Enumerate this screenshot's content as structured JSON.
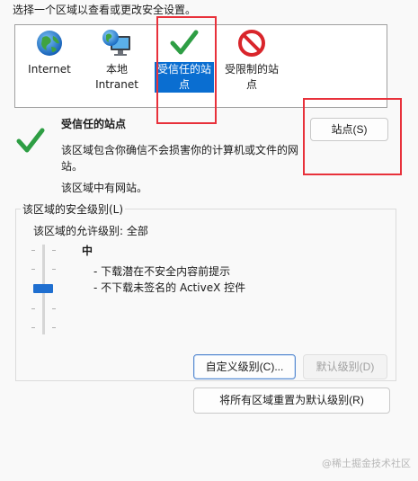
{
  "instruction": "选择一个区域以查看或更改安全设置。",
  "zones": [
    {
      "label": "Internet",
      "icon": "globe-icon"
    },
    {
      "label": "本地\nIntranet",
      "icon": "local-intranet-icon"
    },
    {
      "label": "受信任的站\n点",
      "icon": "checkmark-icon",
      "selected": true
    },
    {
      "label": "受限制的站\n点",
      "icon": "restricted-icon"
    }
  ],
  "selected_zone": {
    "title": "受信任的站点",
    "description": "该区域包含你确信不会损害你的计算机或文件的网站。",
    "description_line1": "该区域包含你确信不会损害你的计算机或文件的网",
    "description_line2": "站。",
    "status": "该区域中有网站。"
  },
  "buttons": {
    "sites": "站点(S)",
    "custom_level": "自定义级别(C)...",
    "default_level": "默认级别(D)",
    "reset_all": "将所有区域重置为默认级别(R)"
  },
  "security_level": {
    "group_label": "该区域的安全级别(L)",
    "allowed_levels": "该区域的允许级别: 全部",
    "current_level": "中",
    "bullets": [
      "- 下载潜在不安全内容前提示",
      "- 不下载未签名的 ActiveX 控件"
    ]
  },
  "watermark": "@稀土掘金技术社区",
  "colors": {
    "selection": "#0a6ed1",
    "annotation_red": "#e8313b",
    "check_green": "#2e9e44",
    "slider_thumb": "#1f6fd0"
  }
}
